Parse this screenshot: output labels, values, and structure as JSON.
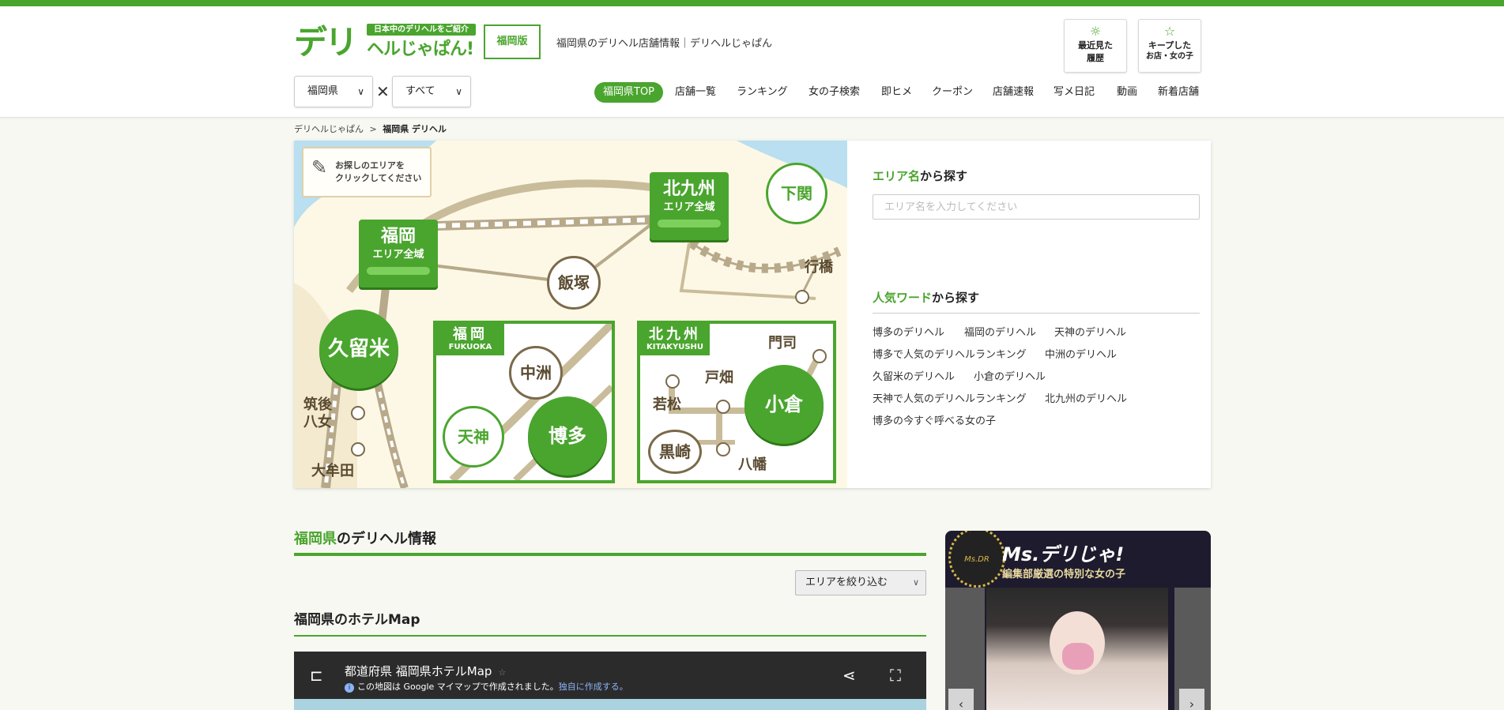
{
  "header": {
    "logo_main": "デリ",
    "logo_tag": "日本中のデリヘルをご紹介",
    "logo_sub": "ヘルじゃぱん!",
    "edition": "福岡版",
    "site_title": "福岡県のデリヘル店舗情報｜デリヘルじゃぱん",
    "history_l1": "最近見た",
    "history_l2": "履歴",
    "keep_l1": "キープした",
    "keep_l2": "お店・女の子",
    "pref_select": "福岡県",
    "area_select": "すべて",
    "times": "✕"
  },
  "nav": [
    "福岡県TOP",
    "店舗一覧",
    "ランキング",
    "女の子検索",
    "即ヒメ",
    "クーポン",
    "店舗速報",
    "写メ日記",
    "動画",
    "新着店舗"
  ],
  "breadcrumb": {
    "home": "デリヘルじゃぱん",
    "sep": ">",
    "current": "福岡県 デリヘル"
  },
  "map": {
    "note_l1": "お探しのエリアを",
    "note_l2": "クリックしてください",
    "fukuoka_area": "福岡",
    "fukuoka_sub": "エリア全域",
    "kitakyushu_area": "北九州",
    "kitakyushu_sub": "エリア全域",
    "shimonoseki": "下関",
    "yukuhashi": "行橋",
    "iizuka": "飯塚",
    "kurume": "久留米",
    "chikugo_l1": "筑後",
    "chikugo_l2": "八女",
    "omuta": "大牟田",
    "box1_name": "福岡",
    "box1_sub": "FUKUOKA",
    "nakasu": "中洲",
    "tenjin": "天神",
    "hakata": "博多",
    "box2_name": "北九州",
    "box2_sub": "KITAKYUSHU",
    "mojiko": "門司",
    "tobata": "戸畑",
    "wakamatsu": "若松",
    "kokura": "小倉",
    "kurosaki": "黒崎",
    "yahata": "八幡"
  },
  "search": {
    "area_h_green": "エリア名",
    "area_h_rest": "から探す",
    "area_placeholder": "エリア名を入力してください",
    "popular_h_green": "人気ワード",
    "popular_h_rest": "から探す",
    "words": [
      "博多のデリヘル",
      "福岡のデリヘル",
      "天神のデリヘル",
      "博多で人気のデリヘルランキング",
      "中洲のデリヘル",
      "久留米のデリヘル",
      "小倉のデリヘル",
      "天神で人気のデリヘルランキング",
      "北九州のデリヘル",
      "博多の今すぐ呼べる女の子"
    ]
  },
  "info": {
    "title_green": "福岡県",
    "title_rest": "のデリヘル情報",
    "filter": "エリアを絞り込む",
    "hotel_title": "福岡県のホテルMap",
    "map_title": "都道府県 福岡県ホテルMap",
    "map_star": "☆",
    "map_note": "この地図は Google マイマップで作成されました。",
    "map_link": "独自に作成する。"
  },
  "msd": {
    "badge": "Ms.DR",
    "title": "Ms.デリじゃ!",
    "sub": "編集部厳選の特別な女の子"
  },
  "colors": {
    "brand": "#4aa52e",
    "brand_dark": "#2e7a19"
  }
}
